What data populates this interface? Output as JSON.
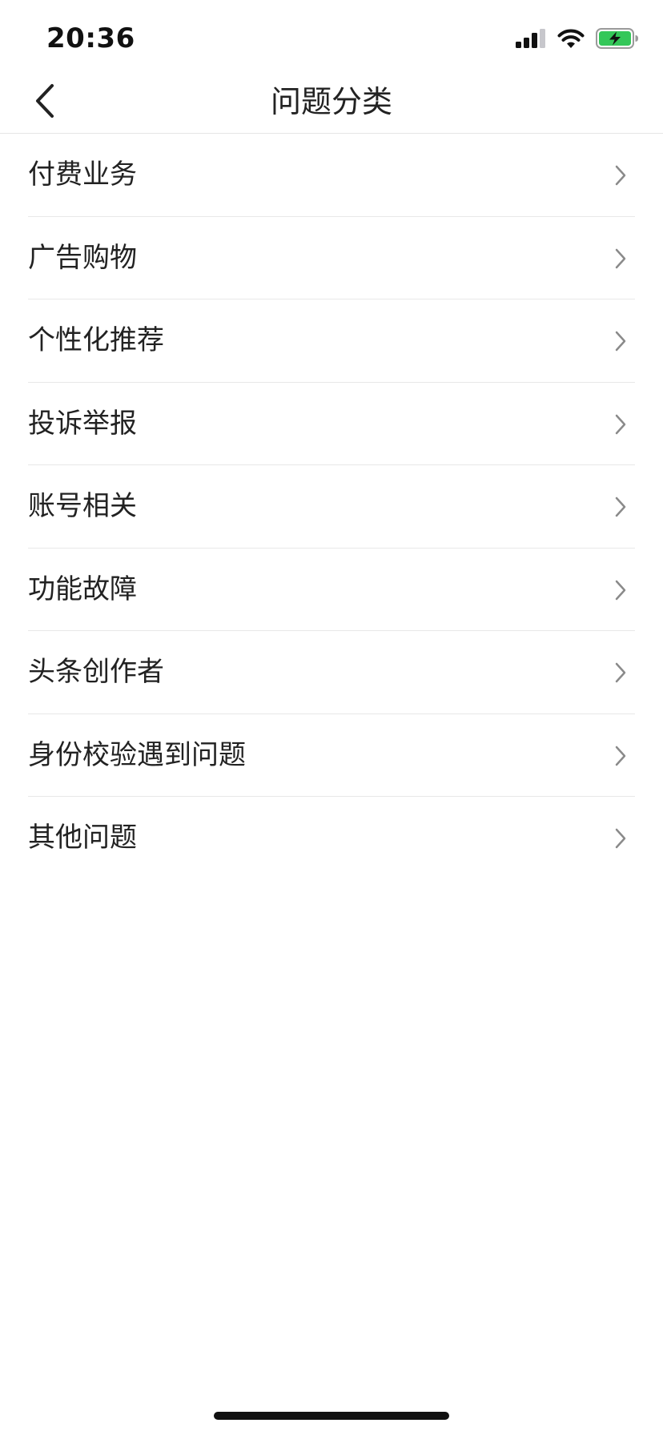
{
  "status_bar": {
    "time": "20:36",
    "battery_color": "#34c759"
  },
  "nav": {
    "title": "问题分类",
    "back_icon": "chevron-left-icon"
  },
  "categories": [
    {
      "label": "付费业务"
    },
    {
      "label": "广告购物"
    },
    {
      "label": "个性化推荐"
    },
    {
      "label": "投诉举报"
    },
    {
      "label": "账号相关"
    },
    {
      "label": "功能故障"
    },
    {
      "label": "头条创作者"
    },
    {
      "label": "身份校验遇到问题"
    },
    {
      "label": "其他问题"
    }
  ],
  "item_icon": "chevron-right-icon"
}
